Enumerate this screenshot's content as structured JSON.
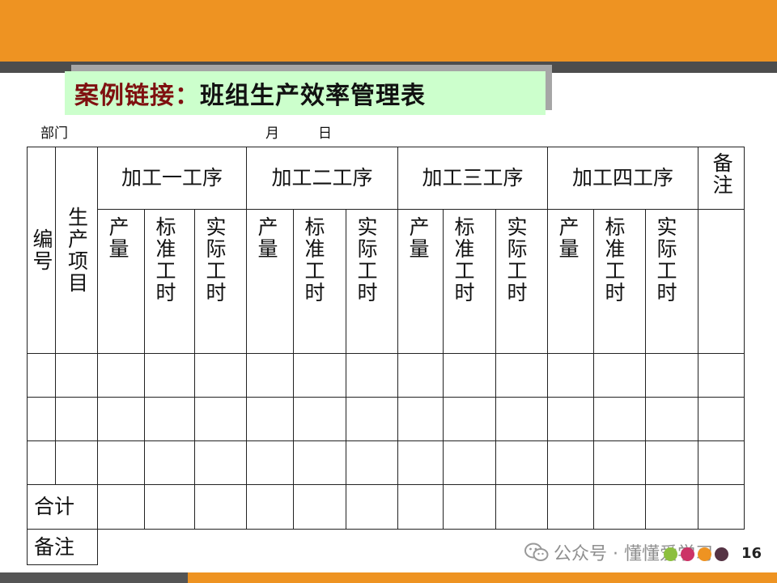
{
  "title": {
    "red": "案例链接：",
    "black": "班组生产效率管理表"
  },
  "subline": {
    "dept": "部门",
    "month": "月",
    "day": "日"
  },
  "table": {
    "col_number": "编号",
    "col_item": "生产项目",
    "col_remark": "备注",
    "processes": [
      "加工一工序",
      "加工二工序",
      "加工三工序",
      "加工四工序"
    ],
    "subcols": [
      "产量",
      "标准工时",
      "实际工时"
    ],
    "row_total": "合计",
    "row_remark": "备注"
  },
  "watermark": "公众号 · 懂懂爱学习",
  "page_number": "16",
  "colors": {
    "orange": "#ee9322",
    "dark_gray": "#4d4d4d",
    "title_bg": "#ccffcc",
    "title_red": "#7f1010"
  },
  "dots": [
    "#8cbf3f",
    "#cc3366",
    "#ee9322",
    "#553344"
  ]
}
